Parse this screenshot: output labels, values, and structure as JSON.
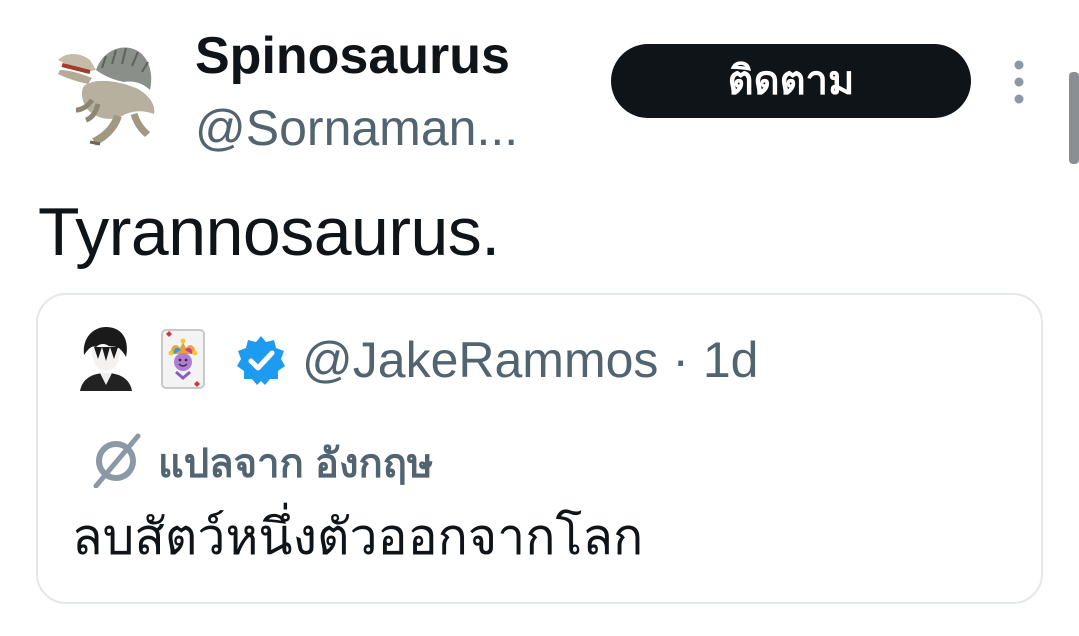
{
  "tweet": {
    "author": {
      "display_name": "Spinosaurus",
      "handle": "@Sornaman..."
    },
    "follow_button_label": "ติดตาม",
    "more_icon": "more-vertical-icon",
    "text": "Tyrannosaurus.",
    "quoted": {
      "handle": "@JakeRammos",
      "separator": "·",
      "time": "1d",
      "emoji": "joker-card",
      "verified": true,
      "translate_label": "แปลจาก อังกฤษ",
      "translate_icon": "translate-icon",
      "text": "ลบสัตว์หนึ่งตัวออกจากโลก"
    }
  },
  "colors": {
    "text_primary": "#0f1419",
    "text_secondary": "#536471",
    "verified_blue": "#1d9bf0",
    "border": "#e4e8eb",
    "button_bg": "#0f1419"
  }
}
